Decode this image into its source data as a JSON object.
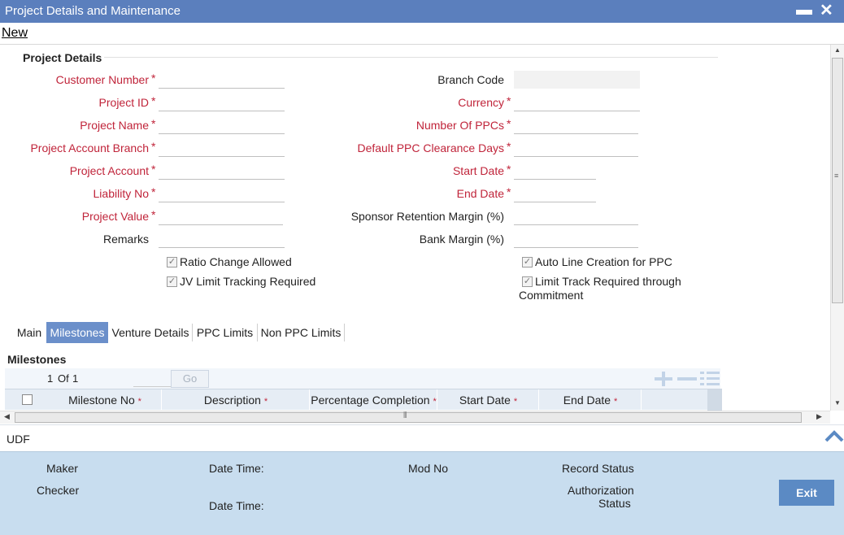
{
  "window": {
    "title": "Project Details and Maintenance",
    "minimize": "▬",
    "close": "✕"
  },
  "toolbar": {
    "new_label": "New"
  },
  "section": {
    "title": "Project Details"
  },
  "left_fields": [
    {
      "label": "Customer Number",
      "required": true
    },
    {
      "label": "Project ID",
      "required": true
    },
    {
      "label": "Project Name",
      "required": true
    },
    {
      "label": "Project Account Branch",
      "required": true
    },
    {
      "label": "Project Account",
      "required": true
    },
    {
      "label": "Liability No",
      "required": true
    },
    {
      "label": "Project Value",
      "required": true
    },
    {
      "label": "Remarks",
      "required": false
    }
  ],
  "right_fields": [
    {
      "label": "Branch Code",
      "required": false
    },
    {
      "label": "Currency",
      "required": true
    },
    {
      "label": "Number Of PPCs",
      "required": true
    },
    {
      "label": "Default PPC Clearance Days",
      "required": true
    },
    {
      "label": "Start Date",
      "required": true
    },
    {
      "label": "End Date",
      "required": true
    },
    {
      "label": "Sponsor Retention Margin (%)",
      "required": false
    },
    {
      "label": "Bank Margin (%)",
      "required": false
    }
  ],
  "required_mark": "*",
  "checkboxes": {
    "ratio_change": "Ratio Change Allowed",
    "jv_limit": "JV Limit Tracking Required",
    "auto_line": "Auto Line Creation for PPC",
    "limit_track_1": "Limit Track Required through",
    "limit_track_2": "Commitment",
    "check_glyph": "✓"
  },
  "tabs": [
    "Main",
    "Milestones",
    "Venture Details",
    "PPC Limits",
    "Non PPC Limits"
  ],
  "milestones": {
    "title": "Milestones",
    "pager": {
      "current": "1",
      "of_label": "Of",
      "total": "1",
      "go_label": "Go"
    },
    "columns": [
      "Milestone No",
      "Description",
      "Percentage Completion",
      "Start Date",
      "End Date"
    ]
  },
  "udf": {
    "label": "UDF"
  },
  "footer": {
    "maker": "Maker",
    "checker": "Checker",
    "date_time": "Date Time:",
    "mod_no": "Mod No",
    "record_status": "Record Status",
    "auth_status_1": "Authorization",
    "auth_status_2": "Status",
    "exit_label": "Exit"
  },
  "icons": {
    "first": "first-page-icon",
    "prev": "prev-page-icon",
    "next": "next-page-icon",
    "last": "last-page-icon",
    "add": "add-row-icon",
    "delete": "delete-row-icon",
    "view": "single-view-icon"
  },
  "colors": {
    "title_bar": "#5b7fbd",
    "required": "#c0243a",
    "active_tab": "#6b8fca",
    "footer": "#c8ddef",
    "exit_button": "#5b8ac4"
  }
}
